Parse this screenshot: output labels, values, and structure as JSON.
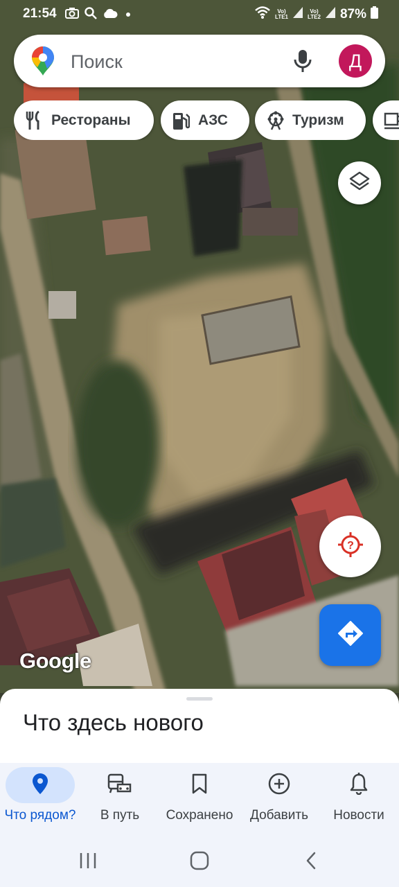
{
  "status_bar": {
    "time": "21:54",
    "sim1": "LTE1",
    "sim2": "LTE2",
    "volte": "Vo)",
    "battery": "87%"
  },
  "search": {
    "placeholder": "Поиск",
    "avatar_letter": "Д"
  },
  "chips": [
    {
      "label": "Рестораны",
      "icon": "fork-knife-icon"
    },
    {
      "label": "АЗС",
      "icon": "gas-station-icon"
    },
    {
      "label": "Туризм",
      "icon": "ferris-wheel-icon"
    },
    {
      "label": "",
      "icon": "coffee-cup-icon"
    }
  ],
  "map": {
    "attribution": "Google",
    "layers_icon": "layers-icon",
    "locate_icon": "location-unknown-icon",
    "directions_icon": "directions-arrow-icon",
    "colors": {
      "accent": "#1a73e8",
      "locate_red": "#d93025"
    }
  },
  "sheet": {
    "title": "Что здесь нового"
  },
  "bottom_nav": {
    "items": [
      {
        "label": "Что рядом?",
        "icon": "location-pin-icon",
        "active": true
      },
      {
        "label": "В путь",
        "icon": "commute-icon",
        "active": false
      },
      {
        "label": "Сохранено",
        "icon": "bookmark-icon",
        "active": false
      },
      {
        "label": "Добавить",
        "icon": "add-circle-icon",
        "active": false
      },
      {
        "label": "Новости",
        "icon": "bell-icon",
        "active": false
      }
    ]
  },
  "colors": {
    "active_nav": "#0b57d0",
    "active_pill": "#d3e3fd",
    "avatar_bg": "#c2185b"
  }
}
